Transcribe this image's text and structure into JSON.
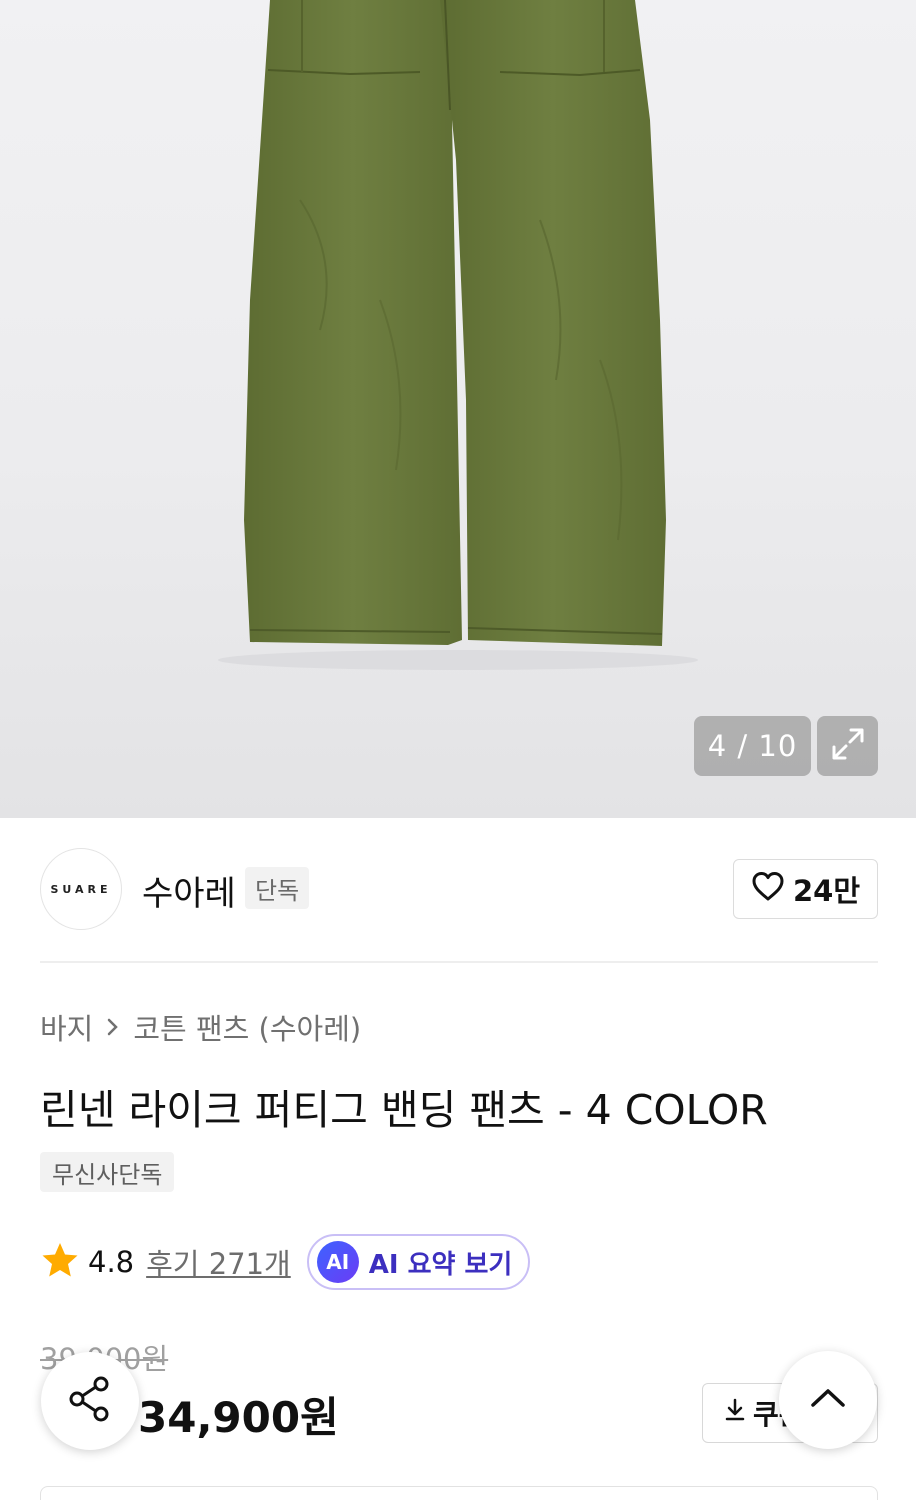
{
  "gallery": {
    "counter": "4 / 10",
    "expand_icon": "expand-icon"
  },
  "brand": {
    "logo_text": "SUARE",
    "name": "수아레",
    "badge": "단독",
    "like_count": "24만"
  },
  "breadcrumb": {
    "category": "바지",
    "subcategory": "코튼 팬츠 (수아레)"
  },
  "product": {
    "title": "린넨 라이크 퍼티그 밴딩 팬츠 - 4 COLOR",
    "exclusive_badge": "무신사단독",
    "rating": "4.8",
    "review_link": "후기 271개",
    "ai_badge": "AI",
    "ai_summary": "AI 요약 보기",
    "original_price": "39,000원",
    "sale_price": "34,900원",
    "coupon_label": "쿠폰"
  },
  "colors": {
    "pants": "#6b7a3e",
    "star": "#ffab00",
    "ai_accent": "#3c2fbf"
  }
}
